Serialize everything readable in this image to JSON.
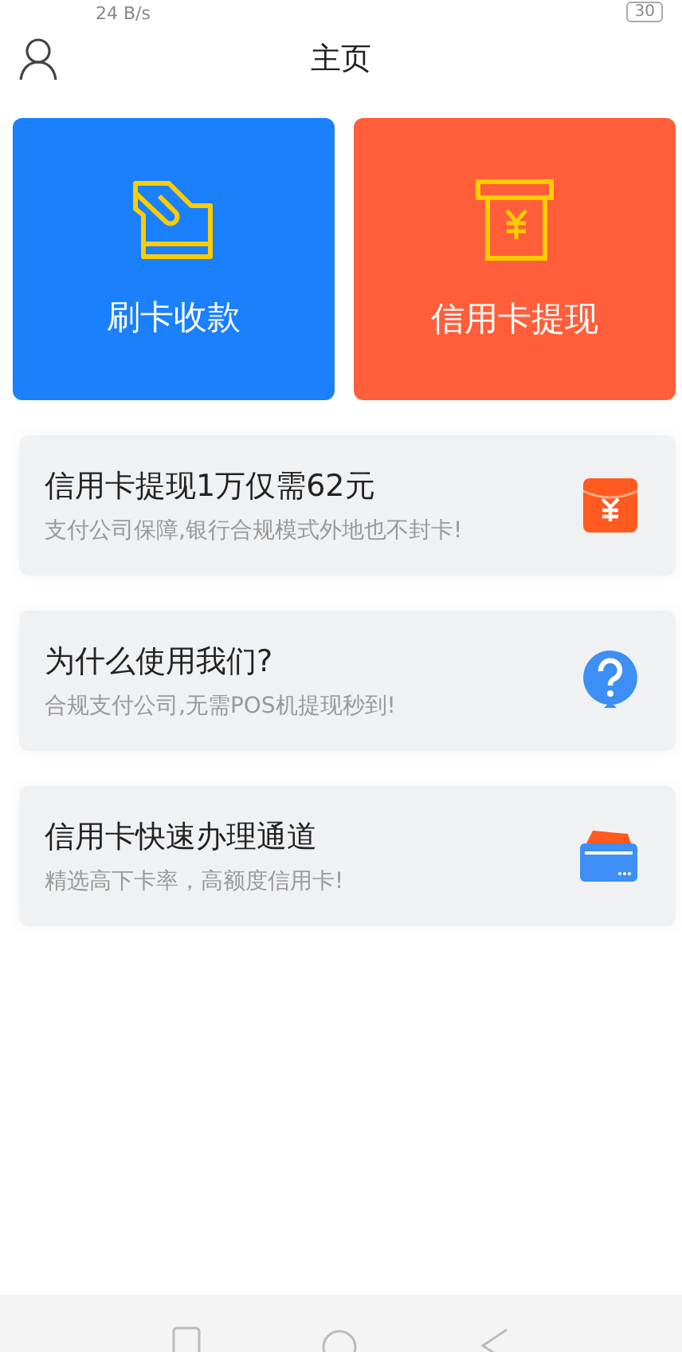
{
  "status_bar": {
    "speed": "24 B/s",
    "battery": "30"
  },
  "header": {
    "title": "主页"
  },
  "tiles": [
    {
      "label": "刷卡收款",
      "kind": "swipe",
      "color": "#1a80fc"
    },
    {
      "label": "信用卡提现",
      "kind": "cash",
      "color": "#ff5e3a"
    }
  ],
  "items": [
    {
      "title": "信用卡提现1万仅需62元",
      "subtitle": "支付公司保障,银行合规模式外地也不封卡!",
      "kind": "redpacket"
    },
    {
      "title": "为什么使用我们?",
      "subtitle": "合规支付公司,无需POS机提现秒到!",
      "kind": "question"
    },
    {
      "title": "信用卡快速办理通道",
      "subtitle": "精选高下卡率，高额度信用卡!",
      "kind": "card"
    }
  ]
}
